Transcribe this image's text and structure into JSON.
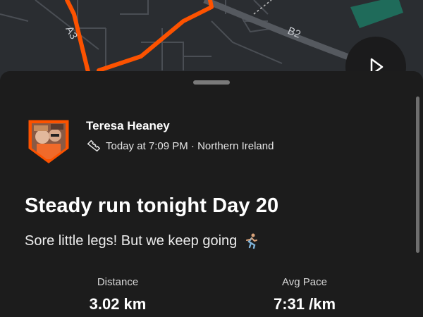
{
  "map": {
    "road_labels": [
      "A3",
      "B2"
    ],
    "route_color": "#fc5200",
    "play_icon": "play-icon"
  },
  "activity": {
    "athlete_name": "Teresa Heaney",
    "meta": "Today at 7:09 PM · Northern Ireland",
    "sport_icon": "shoe-icon",
    "title": "Steady run tonight Day 20",
    "description": "Sore little legs! But we keep going",
    "description_emoji": "runner-emoji",
    "stats": [
      {
        "label": "Distance",
        "value": "3.02 km"
      },
      {
        "label": "Avg Pace",
        "value": "7:31 /km"
      }
    ]
  },
  "colors": {
    "accent": "#fc5200",
    "sheet_background": "#1c1c1c",
    "map_background": "#2a2d31"
  }
}
